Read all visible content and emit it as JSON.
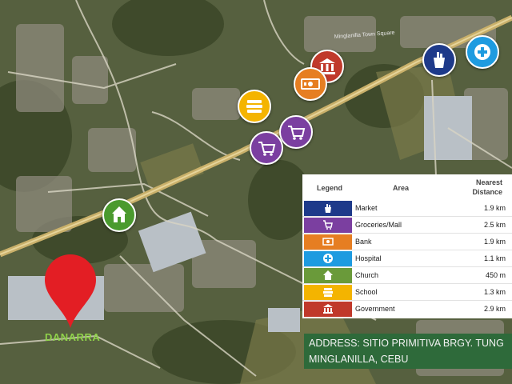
{
  "map": {
    "road_label": "Minglanilla Town Square"
  },
  "project": {
    "name": "DANARRA"
  },
  "pois": [
    {
      "category": "government",
      "icon": "bank-building-icon",
      "color": "#c0392b"
    },
    {
      "category": "bank",
      "icon": "money-bill-icon",
      "color": "#e67e22"
    },
    {
      "category": "school",
      "icon": "books-stack-icon",
      "color": "#f4b400"
    },
    {
      "category": "groceries",
      "icon": "shopping-cart-icon",
      "color": "#7b3fa0"
    },
    {
      "category": "groceries",
      "icon": "shopping-cart-icon",
      "color": "#7b3fa0"
    },
    {
      "category": "market",
      "icon": "grocery-bag-icon",
      "color": "#1e3a8a"
    },
    {
      "category": "hospital",
      "icon": "medical-cross-icon",
      "color": "#1e9be0"
    },
    {
      "category": "church",
      "icon": "church-icon",
      "color": "#4a9a2e"
    }
  ],
  "legend": {
    "col_legend": "Legend",
    "col_area": "Area",
    "col_distance_1": "Nearest",
    "col_distance_2": "Distance",
    "rows": [
      {
        "area": "Market",
        "distance": "1.9 km",
        "color": "#1e3a8a",
        "icon": "grocery-bag-icon"
      },
      {
        "area": "Groceries/Mall",
        "distance": "2.5 km",
        "color": "#7b3fa0",
        "icon": "shopping-cart-icon"
      },
      {
        "area": "Bank",
        "distance": "1.9 km",
        "color": "#e67e22",
        "icon": "money-bill-icon"
      },
      {
        "area": "Hospital",
        "distance": "1.1 km",
        "color": "#1e9be0",
        "icon": "medical-cross-icon"
      },
      {
        "area": "Church",
        "distance": "450 m",
        "color": "#6a9a3a",
        "icon": "church-icon"
      },
      {
        "area": "School",
        "distance": "1.3 km",
        "color": "#f4b400",
        "icon": "books-stack-icon"
      },
      {
        "area": "Government",
        "distance": "2.9 km",
        "color": "#c0392b",
        "icon": "bank-building-icon"
      }
    ]
  },
  "address": {
    "line1": "ADDRESS: SITIO PRIMITIVA BRGY. TUNG",
    "line2": "MINGLANILLA, CEBU"
  }
}
